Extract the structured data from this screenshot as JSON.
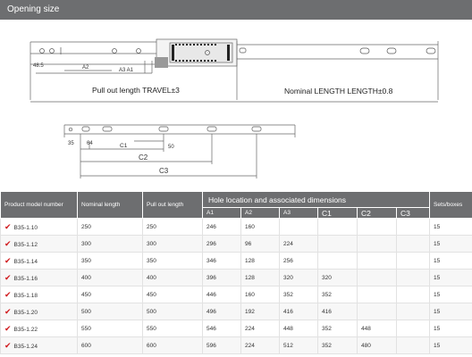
{
  "header": {
    "title": "Opening size"
  },
  "diagram": {
    "labels": {
      "dim_48_5": "48.5",
      "a2": "A2",
      "a3a1": "A3 A1",
      "travel": "Pull out length TRAVEL±3",
      "nominal": "Nominal LENGTH LENGTH±0.8",
      "dim_35": "35",
      "dim_64": "64",
      "dim_50": "50",
      "c1": "C1",
      "c2": "C2",
      "c3": "C3"
    }
  },
  "table": {
    "headers": {
      "model": "Product model number",
      "nominal": "Nominal length",
      "pull": "Pull out length",
      "group": "Hole location and associated dimensions",
      "sets": "Sets/boxes",
      "sub": [
        "A1",
        "A2",
        "A3",
        "C1",
        "C2",
        "C3"
      ]
    },
    "rows": [
      {
        "model": "B35-1.10",
        "nominal": "250",
        "pull": "250",
        "a1": "246",
        "a2": "160",
        "a3": "",
        "c1": "",
        "c2": "",
        "c3": "",
        "sets": "15"
      },
      {
        "model": "B35-1.12",
        "nominal": "300",
        "pull": "300",
        "a1": "296",
        "a2": "96",
        "a3": "224",
        "c1": "",
        "c2": "",
        "c3": "",
        "sets": "15"
      },
      {
        "model": "B35-1.14",
        "nominal": "350",
        "pull": "350",
        "a1": "346",
        "a2": "128",
        "a3": "256",
        "c1": "",
        "c2": "",
        "c3": "",
        "sets": "15"
      },
      {
        "model": "B35-1.16",
        "nominal": "400",
        "pull": "400",
        "a1": "396",
        "a2": "128",
        "a3": "320",
        "c1": "320",
        "c2": "",
        "c3": "",
        "sets": "15"
      },
      {
        "model": "B35-1.18",
        "nominal": "450",
        "pull": "450",
        "a1": "446",
        "a2": "160",
        "a3": "352",
        "c1": "352",
        "c2": "",
        "c3": "",
        "sets": "15"
      },
      {
        "model": "B35-1.20",
        "nominal": "500",
        "pull": "500",
        "a1": "496",
        "a2": "192",
        "a3": "416",
        "c1": "416",
        "c2": "",
        "c3": "",
        "sets": "15"
      },
      {
        "model": "B35-1.22",
        "nominal": "550",
        "pull": "550",
        "a1": "546",
        "a2": "224",
        "a3": "448",
        "c1": "352",
        "c2": "448",
        "c3": "",
        "sets": "15"
      },
      {
        "model": "B35-1.24",
        "nominal": "600",
        "pull": "600",
        "a1": "596",
        "a2": "224",
        "a3": "512",
        "c1": "352",
        "c2": "480",
        "c3": "",
        "sets": "15"
      }
    ]
  }
}
